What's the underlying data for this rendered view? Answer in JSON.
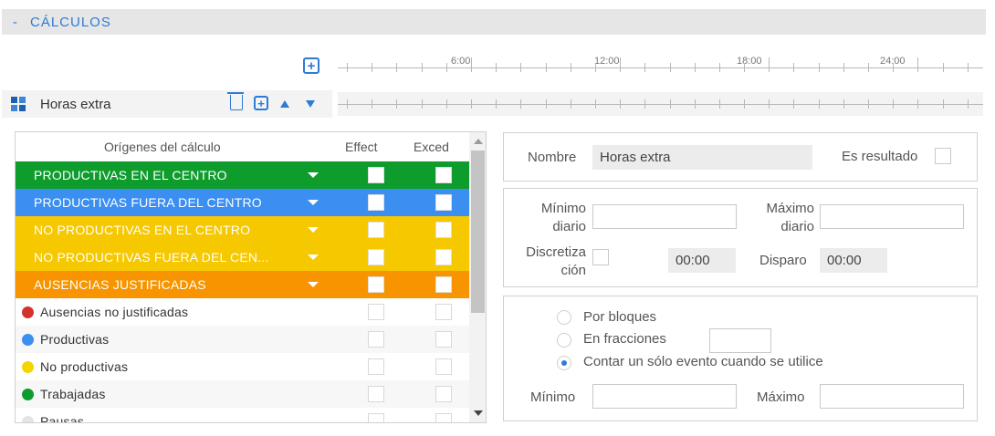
{
  "section": {
    "dash": "-",
    "title": "CÁLCULOS"
  },
  "timeline": {
    "labels": [
      "6:00",
      "12:00",
      "18:00",
      "24:00"
    ]
  },
  "rule": {
    "name": "Horas extra"
  },
  "origins_table": {
    "headers": {
      "origin": "Orígenes del cálculo",
      "effect": "Effect",
      "exceed": "Exced"
    },
    "groups": [
      {
        "label": "PRODUCTIVAS EN EL CENTRO",
        "color": "#0e9c2d"
      },
      {
        "label": "PRODUCTIVAS FUERA DEL CENTRO",
        "color": "#3b8ff0"
      },
      {
        "label": "NO PRODUCTIVAS EN EL CENTRO",
        "color": "#f6c800"
      },
      {
        "label": "NO PRODUCTIVAS FUERA DEL CEN...",
        "color": "#f6c800"
      },
      {
        "label": "AUSENCIAS JUSTIFICADAS",
        "color": "#f79400"
      }
    ],
    "items": [
      {
        "label": "Ausencias no justificadas",
        "dot": "#d4312d"
      },
      {
        "label": "Productivas",
        "dot": "#3b8ff0"
      },
      {
        "label": "No productivas",
        "dot": "#f6d400"
      },
      {
        "label": "Trabajadas",
        "dot": "#0e9c2d"
      },
      {
        "label": "Pausas",
        "dot": "#e4e4e4"
      }
    ]
  },
  "form": {
    "name_label": "Nombre",
    "name_value": "Horas extra",
    "is_result_label": "Es resultado",
    "min_daily_label_1": "Mínimo",
    "min_daily_label_2": "diario",
    "max_daily_label_1": "Máximo",
    "max_daily_label_2": "diario",
    "discretization_label_1": "Discretiza",
    "discretization_label_2": "ción",
    "discretization_value": "00:00",
    "trigger_label": "Disparo",
    "trigger_value": "00:00",
    "mode_options": [
      "Por bloques",
      "En fracciones",
      "Contar un sólo evento cuando se utilice"
    ],
    "selected_mode": "Contar un sólo evento cuando se utilice",
    "min_label": "Mínimo",
    "max_label": "Máximo"
  }
}
